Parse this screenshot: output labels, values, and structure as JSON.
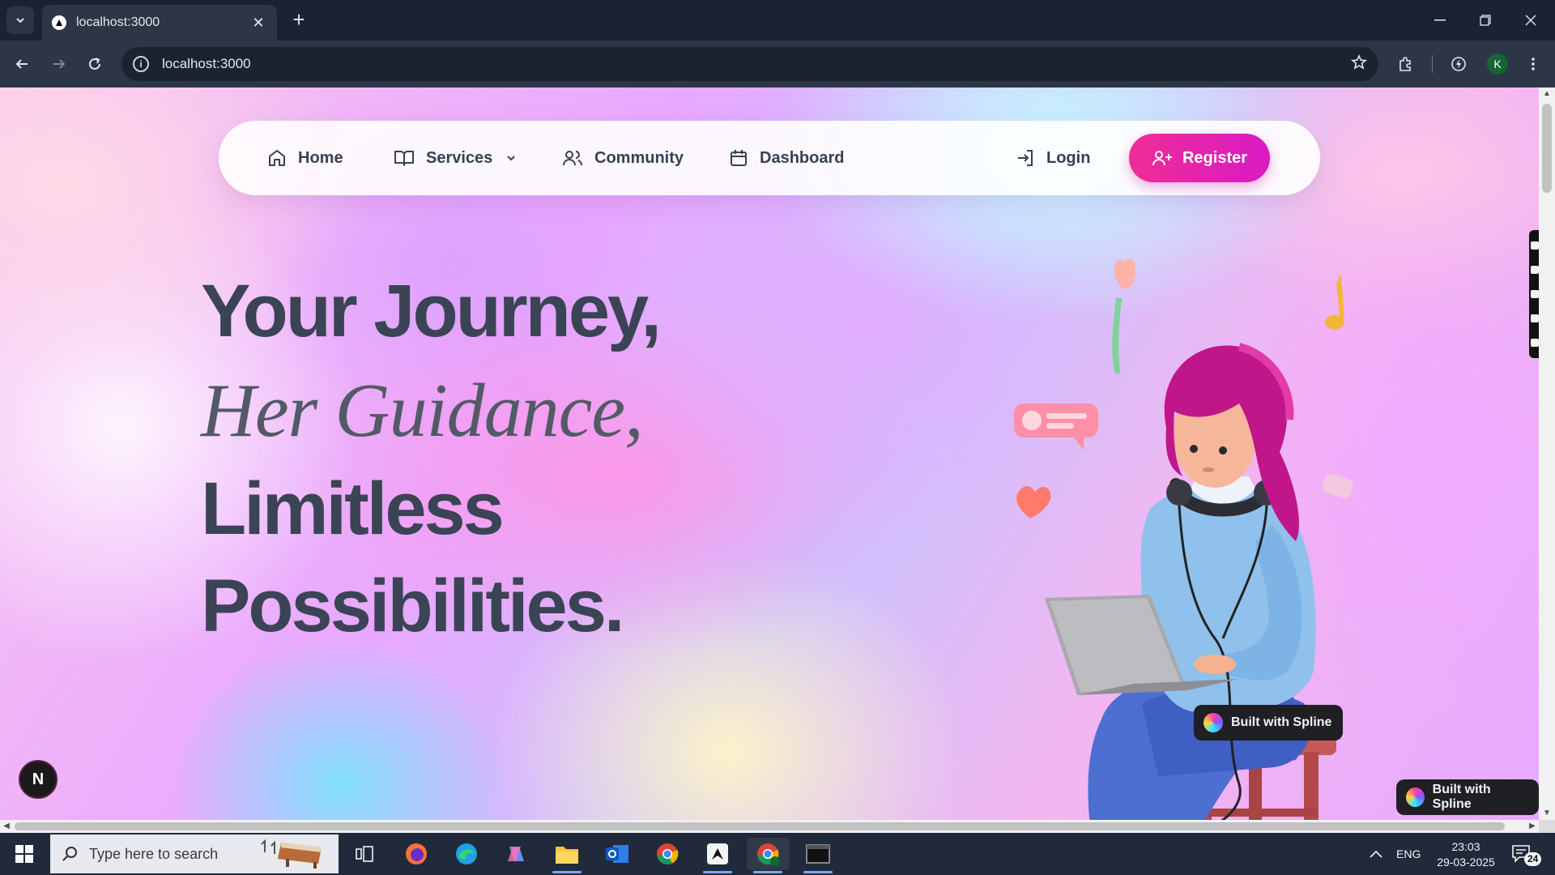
{
  "browser": {
    "tab_title": "localhost:3000",
    "url": "localhost:3000",
    "profile_initial": "K"
  },
  "nav": {
    "home": "Home",
    "services": "Services",
    "community": "Community",
    "dashboard": "Dashboard",
    "login": "Login",
    "register": "Register"
  },
  "hero": {
    "line1": "Your Journey,",
    "line2": "Her Guidance,",
    "line3": "Limitless",
    "line4": "Possibilities."
  },
  "badges": {
    "spline_inner": "Built with Spline",
    "spline_outer": "Built with Spline",
    "next_letter": "N"
  },
  "taskbar": {
    "search_placeholder": "Type here to search",
    "language": "ENG",
    "time": "23:03",
    "date": "29-03-2025",
    "notification_count": "24"
  },
  "colors": {
    "accent": "#e91e9c",
    "text_dark": "#3b4454"
  }
}
